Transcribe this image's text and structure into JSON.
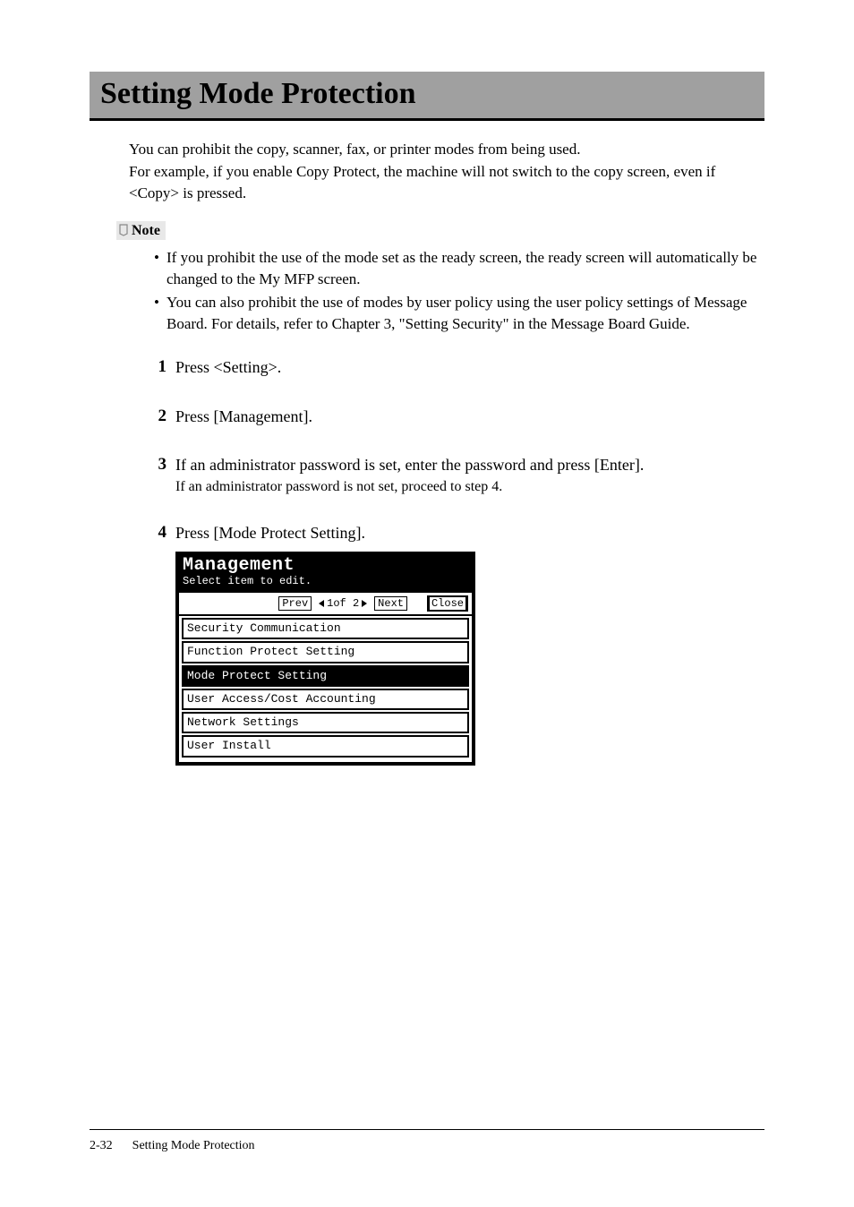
{
  "title": "Setting Mode Protection",
  "intro": "You can prohibit the copy, scanner, fax, or printer modes from being used.\nFor example, if you enable Copy Protect, the machine will not switch to the copy screen, even if <Copy> is pressed.",
  "note_label": "Note",
  "note_bullets": [
    "If you prohibit the use of the mode set as the ready screen, the ready screen will automatically be changed to the My MFP screen.",
    "You can also prohibit the use of modes by user policy using the user policy settings of Message Board. For details, refer to Chapter 3, \"Setting Security\" in the Message Board Guide."
  ],
  "steps": [
    {
      "num": "1",
      "text": "Press <Setting>."
    },
    {
      "num": "2",
      "text": "Press [Management]."
    },
    {
      "num": "3",
      "text": "If an administrator password is set, enter the password and press [Enter].",
      "sub": "If an administrator password is not set, proceed to step 4."
    },
    {
      "num": "4",
      "text": "Press [Mode Protect Setting]."
    }
  ],
  "lcd": {
    "title": "Management",
    "subtitle": "Select item to edit.",
    "prev": "Prev",
    "page_indicator": "1of 2",
    "next": "Next",
    "close": "Close",
    "items": [
      {
        "label": "Security Communication",
        "selected": false
      },
      {
        "label": "Function Protect Setting",
        "selected": false
      },
      {
        "label": "Mode Protect Setting",
        "selected": true
      },
      {
        "label": "User Access/Cost Accounting",
        "selected": false
      },
      {
        "label": "Network Settings",
        "selected": false
      },
      {
        "label": "User Install",
        "selected": false
      }
    ]
  },
  "footer": {
    "page": "2-32",
    "title": "Setting Mode Protection"
  }
}
